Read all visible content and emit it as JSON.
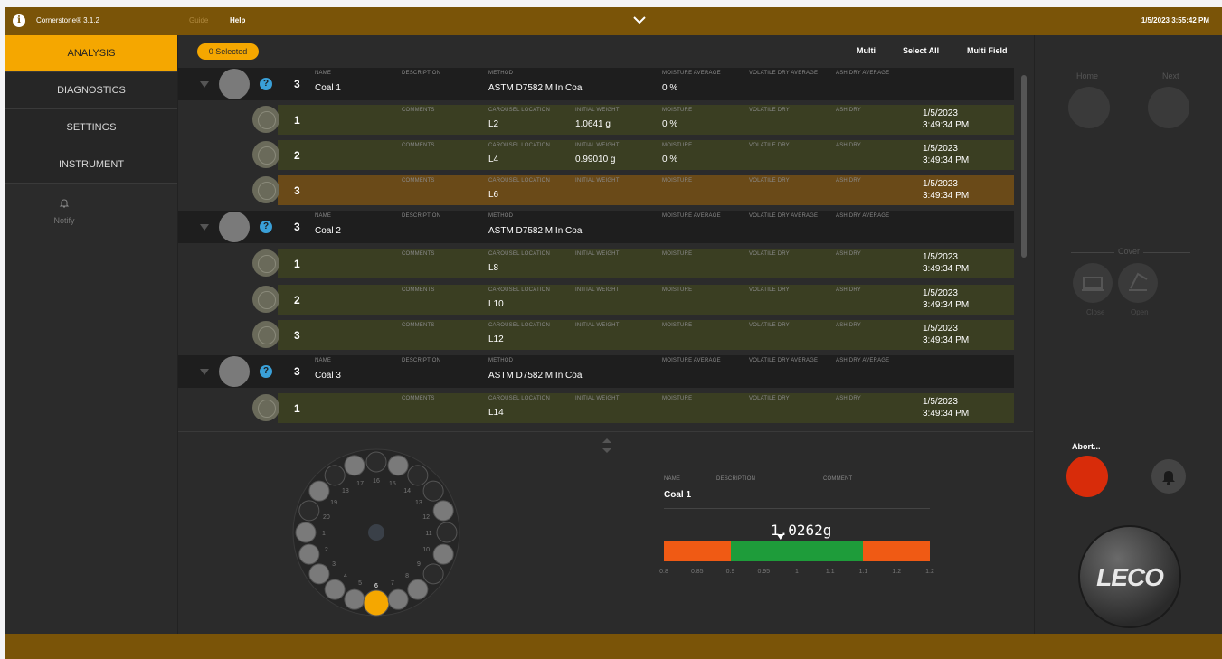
{
  "topbar": {
    "app_name": "Cornerstone® 3.1.2",
    "guide": "Guide",
    "help": "Help",
    "datetime": "1/5/2023 3:55:42 PM"
  },
  "nav": {
    "items": [
      "ANALYSIS",
      "DIAGNOSTICS",
      "SETTINGS",
      "INSTRUMENT"
    ],
    "notify": "Notify"
  },
  "toolbar": {
    "selected": "0 Selected",
    "multi": "Multi",
    "select_all": "Select All",
    "multi_field": "Multi Field"
  },
  "labels": {
    "name": "NAME",
    "description": "DESCRIPTION",
    "method": "METHOD",
    "moisture_avg": "MOISTURE AVERAGE",
    "volatile_dry_avg": "VOLATILE DRY AVERAGE",
    "ash_dry_avg": "ASH DRY AVERAGE",
    "comments": "COMMENTS",
    "carousel_location": "CAROUSEL LOCATION",
    "initial_weight": "INITIAL WEIGHT",
    "moisture": "MOISTURE",
    "volatile_dry": "VOLATILE DRY",
    "ash_dry": "ASH DRY"
  },
  "groups": [
    {
      "count": "3",
      "name": "Coal 1",
      "method": "ASTM D7582 M In Coal",
      "moisture_avg": "0 %",
      "samples": [
        {
          "num": "1",
          "location": "L2",
          "weight": "1.0641 g",
          "moisture": "0 %",
          "date": "1/5/2023",
          "time": "3:49:34 PM"
        },
        {
          "num": "2",
          "location": "L4",
          "weight": "0.99010 g",
          "moisture": "0 %",
          "date": "1/5/2023",
          "time": "3:49:34 PM"
        },
        {
          "num": "3",
          "location": "L6",
          "weight": "",
          "moisture": "",
          "date": "1/5/2023",
          "time": "3:49:34 PM"
        }
      ]
    },
    {
      "count": "3",
      "name": "Coal 2",
      "method": "ASTM D7582 M In Coal",
      "moisture_avg": "",
      "samples": [
        {
          "num": "1",
          "location": "L8",
          "weight": "",
          "moisture": "",
          "date": "1/5/2023",
          "time": "3:49:34 PM"
        },
        {
          "num": "2",
          "location": "L10",
          "weight": "",
          "moisture": "",
          "date": "1/5/2023",
          "time": "3:49:34 PM"
        },
        {
          "num": "3",
          "location": "L12",
          "weight": "",
          "moisture": "",
          "date": "1/5/2023",
          "time": "3:49:34 PM"
        }
      ]
    },
    {
      "count": "3",
      "name": "Coal 3",
      "method": "ASTM D7582 M In Coal",
      "moisture_avg": "",
      "samples": [
        {
          "num": "1",
          "location": "L14",
          "weight": "",
          "moisture": "",
          "date": "1/5/2023",
          "time": "3:49:34 PM"
        }
      ]
    }
  ],
  "carousel": {
    "current_position": "6",
    "labels": [
      "1",
      "2",
      "3",
      "4",
      "5",
      "6",
      "7",
      "8",
      "9",
      "10",
      "11",
      "12",
      "13",
      "14",
      "15",
      "16",
      "17",
      "18",
      "19",
      "20"
    ]
  },
  "weighing": {
    "name_label": "NAME",
    "desc_label": "DESCRIPTION",
    "comment_label": "COMMENT",
    "name": "Coal 1",
    "weight": "1.0262g",
    "weight_value": 1.0262,
    "scale_ticks": [
      "0.8",
      "0.85",
      "0.9",
      "0.95",
      "1",
      "1.1",
      "1.1",
      "1.2",
      "1.2"
    ],
    "range_min": 0.8,
    "range_max": 1.2
  },
  "right": {
    "home": "Home",
    "next": "Next",
    "cover": "Cover",
    "close": "Close",
    "open": "Open",
    "abort": "Abort...",
    "logo": "LECO"
  },
  "colors": {
    "accent": "#f5a700",
    "topbar": "#7a5408",
    "abort": "#d82c0a",
    "good": "#1e9c3a",
    "bad": "#f05a14"
  }
}
